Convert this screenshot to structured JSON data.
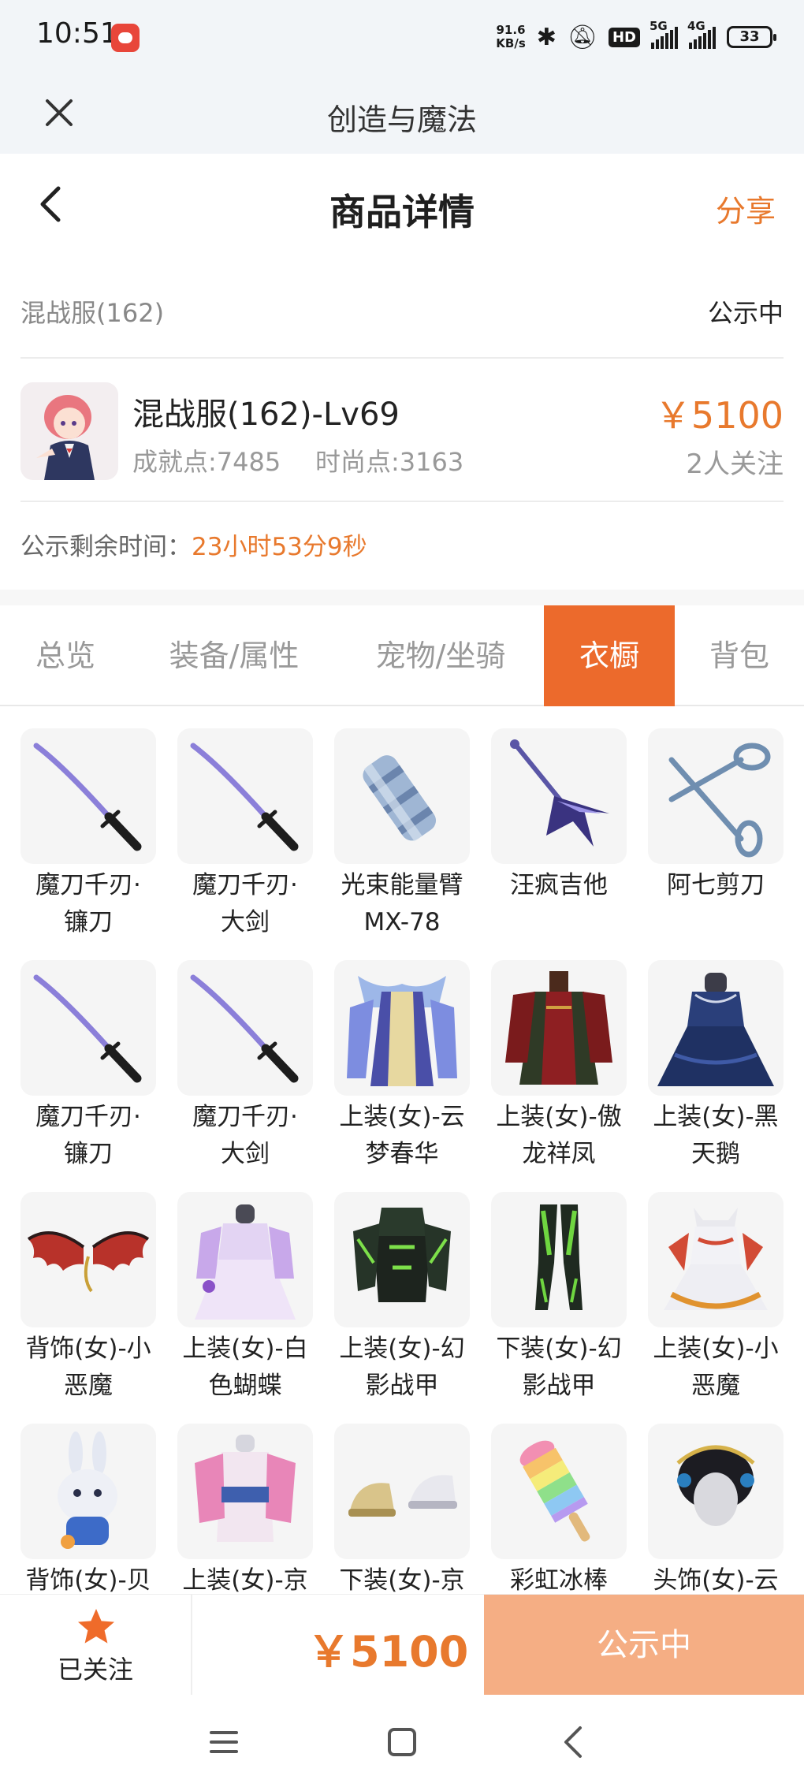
{
  "status_bar": {
    "time": "10:51",
    "net_speed_value": "91.6",
    "net_speed_unit": "KB/s",
    "hd_label": "HD",
    "signal_1_label": "5G",
    "signal_2_label": "4G",
    "battery": "33"
  },
  "app_bar": {
    "title": "创造与魔法"
  },
  "header": {
    "title": "商品详情",
    "share_label": "分享"
  },
  "server": {
    "name": "混战服(162)",
    "status": "公示中"
  },
  "character": {
    "name": "混战服(162)-Lv69",
    "achievement": "成就点:7485",
    "fashion": "时尚点:3163",
    "price": "￥5100",
    "followers": "2人关注"
  },
  "countdown": {
    "label": "公示剩余时间：",
    "value": "23小时53分9秒"
  },
  "tabs": [
    {
      "label": "总览",
      "active": false
    },
    {
      "label": "装备/属性",
      "active": false
    },
    {
      "label": "宠物/坐骑",
      "active": false
    },
    {
      "label": "衣橱",
      "active": true
    },
    {
      "label": "背包",
      "active": false
    }
  ],
  "items": [
    {
      "label_line1": "魔刀千刃·",
      "label_line2": "镰刀",
      "icon": "katana-icon"
    },
    {
      "label_line1": "魔刀千刃·",
      "label_line2": "大剑",
      "icon": "katana-icon"
    },
    {
      "label_line1": "光束能量臂",
      "label_line2": "MX-78",
      "icon": "energy-arm-icon"
    },
    {
      "label_line1": "汪疯吉他",
      "label_line2": "",
      "icon": "guitar-icon"
    },
    {
      "label_line1": "阿七剪刀",
      "label_line2": "",
      "icon": "scissors-icon"
    },
    {
      "label_line1": "魔刀千刃·",
      "label_line2": "镰刀",
      "icon": "katana-icon"
    },
    {
      "label_line1": "魔刀千刃·",
      "label_line2": "大剑",
      "icon": "katana-icon"
    },
    {
      "label_line1": "上装(女)-云",
      "label_line2": "梦春华",
      "icon": "dress-blue-icon"
    },
    {
      "label_line1": "上装(女)-傲",
      "label_line2": "龙祥凤",
      "icon": "dress-red-icon"
    },
    {
      "label_line1": "上装(女)-黑",
      "label_line2": "天鹅",
      "icon": "dress-navy-icon"
    },
    {
      "label_line1": "背饰(女)-小",
      "label_line2": "恶魔",
      "icon": "devil-wings-icon"
    },
    {
      "label_line1": "上装(女)-白",
      "label_line2": "色蝴蝶",
      "icon": "dress-white-icon"
    },
    {
      "label_line1": "上装(女)-幻",
      "label_line2": "影战甲",
      "icon": "armor-top-icon"
    },
    {
      "label_line1": "下装(女)-幻",
      "label_line2": "影战甲",
      "icon": "armor-legs-icon"
    },
    {
      "label_line1": "上装(女)-小",
      "label_line2": "恶魔",
      "icon": "dress-devil-icon"
    },
    {
      "label_line1": "背饰(女)-贝",
      "label_line2": "",
      "icon": "bunny-backpack-icon"
    },
    {
      "label_line1": "上装(女)-京",
      "label_line2": "",
      "icon": "kimono-icon"
    },
    {
      "label_line1": "下装(女)-京",
      "label_line2": "",
      "icon": "sandals-icon"
    },
    {
      "label_line1": "彩虹冰棒",
      "label_line2": "",
      "icon": "popsicle-icon"
    },
    {
      "label_line1": "头饰(女)-云",
      "label_line2": "",
      "icon": "headdress-icon"
    }
  ],
  "bottom_bar": {
    "follow_label": "已关注",
    "price": "￥5100",
    "action_label": "公示中"
  },
  "colors": {
    "accent": "#ec6a2c",
    "price": "#e8792d",
    "button_disabled": "#f5ae84"
  }
}
